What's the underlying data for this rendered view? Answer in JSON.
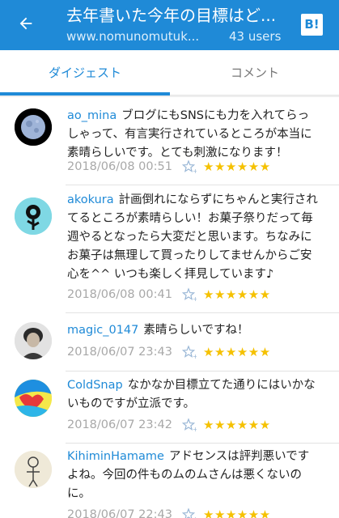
{
  "header": {
    "title": "去年書いた今年の目標はど...",
    "site": "www.nomunomutuk...",
    "users": "43 users",
    "hatena_label": "B!"
  },
  "tabs": [
    {
      "label": "ダイジェスト",
      "active": true
    },
    {
      "label": "コメント",
      "active": false
    }
  ],
  "colors": {
    "accent": "#1f8ad7",
    "star": "#f5c100",
    "date": "#a8a8a8"
  },
  "comments": [
    {
      "user": "ao_mina",
      "text": "ブログにもSNSにも力を入れてらっしゃって、有言実行されているところが本当に素晴らしいです。とても刺激になります！",
      "date": "2018/06/08 00:51",
      "stars": "★★★★★★"
    },
    {
      "user": "akokura",
      "text": "計画倒れにならずにちゃんと実行されてるところが素晴らしい！お菓子祭りだって毎週やるとなったら大変だと思います。ちなみにお菓子は無理して買ったりしてませんからご安心を^^ いつも楽しく拝見しています♪",
      "date": "2018/06/08 00:41",
      "stars": "★★★★★★"
    },
    {
      "user": "magic_0147",
      "text": "素晴らしいですね！",
      "date": "2018/06/07 23:43",
      "stars": "★★★★★★"
    },
    {
      "user": "ColdSnap",
      "text": "なかなか目標立てた通りにはいかないものですが立派です。",
      "date": "2018/06/07 23:42",
      "stars": "★★★★★★"
    },
    {
      "user": "KihiminHamame",
      "text": "アドセンスは評判悪いですよね。今回の件ものムのムさんは悪くないのに。",
      "date": "2018/06/07 22:43",
      "stars": "★★★★★★"
    }
  ]
}
